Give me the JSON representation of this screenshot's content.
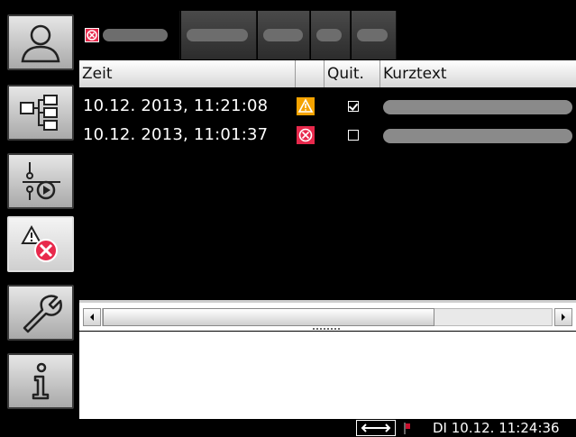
{
  "sidebar": {
    "items": [
      {
        "icon": "user-icon"
      },
      {
        "icon": "hierarchy-icon"
      },
      {
        "icon": "control-icon"
      },
      {
        "icon": "alarm-icon",
        "active": true
      },
      {
        "icon": "wrench-icon"
      },
      {
        "icon": "info-icon"
      }
    ]
  },
  "table": {
    "columns": {
      "time": "Zeit",
      "status": "",
      "ack": "Quit.",
      "text": "Kurztext"
    },
    "rows": [
      {
        "time": "10.12. 2013, 11:21:08",
        "status_icon": "warning-icon",
        "acknowledged": true
      },
      {
        "time": "10.12. 2013, 11:01:37",
        "status_icon": "error-icon",
        "acknowledged": false
      }
    ]
  },
  "statusbar": {
    "datetime": "DI 10.12. 11:24:36"
  },
  "colors": {
    "warning": "#f5a300",
    "error": "#e8294c",
    "header_bg": "#eeeeee"
  }
}
